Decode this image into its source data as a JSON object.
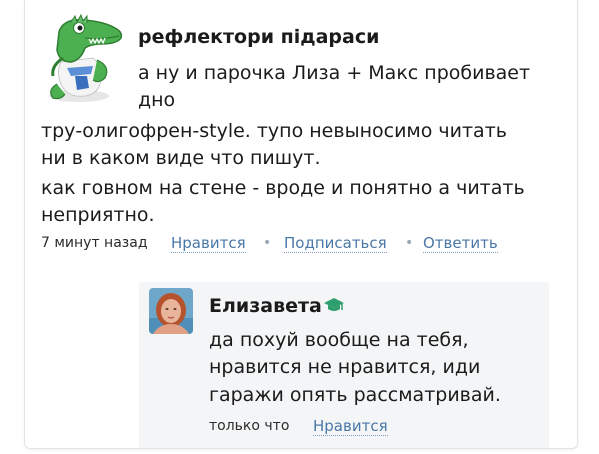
{
  "comment": {
    "author": "рефлектори підараси",
    "text_lines": [
      "а ну и парочка Лиза + Макс пробивает",
      "дно",
      "тру-олигофрен-style. тупо невыносимо читать",
      "ни в каком виде что пишут.",
      "как говном на стене - вроде и понятно а читать",
      "неприятно."
    ],
    "time": "7 минут назад",
    "like_label": "Нравится",
    "subscribe_label": "Подписаться",
    "reply_label": "Ответить",
    "separator": "•",
    "avatar_icon": "crocodile-avatar-icon"
  },
  "reply": {
    "author": "Елизавета",
    "badge_icon": "graduation-cap-icon",
    "badge_color": "#2f9e6e",
    "text_lines": [
      "да похуй вообще на тебя,",
      "нравится не нравится, иди",
      "гаражи опять рассматривай."
    ],
    "time": "только что",
    "like_label": "Нравится",
    "avatar_icon": "user-photo-avatar"
  },
  "colors": {
    "link": "#4a78a8",
    "reply_background": "#f4f5f6",
    "text": "#1b1b1b"
  }
}
